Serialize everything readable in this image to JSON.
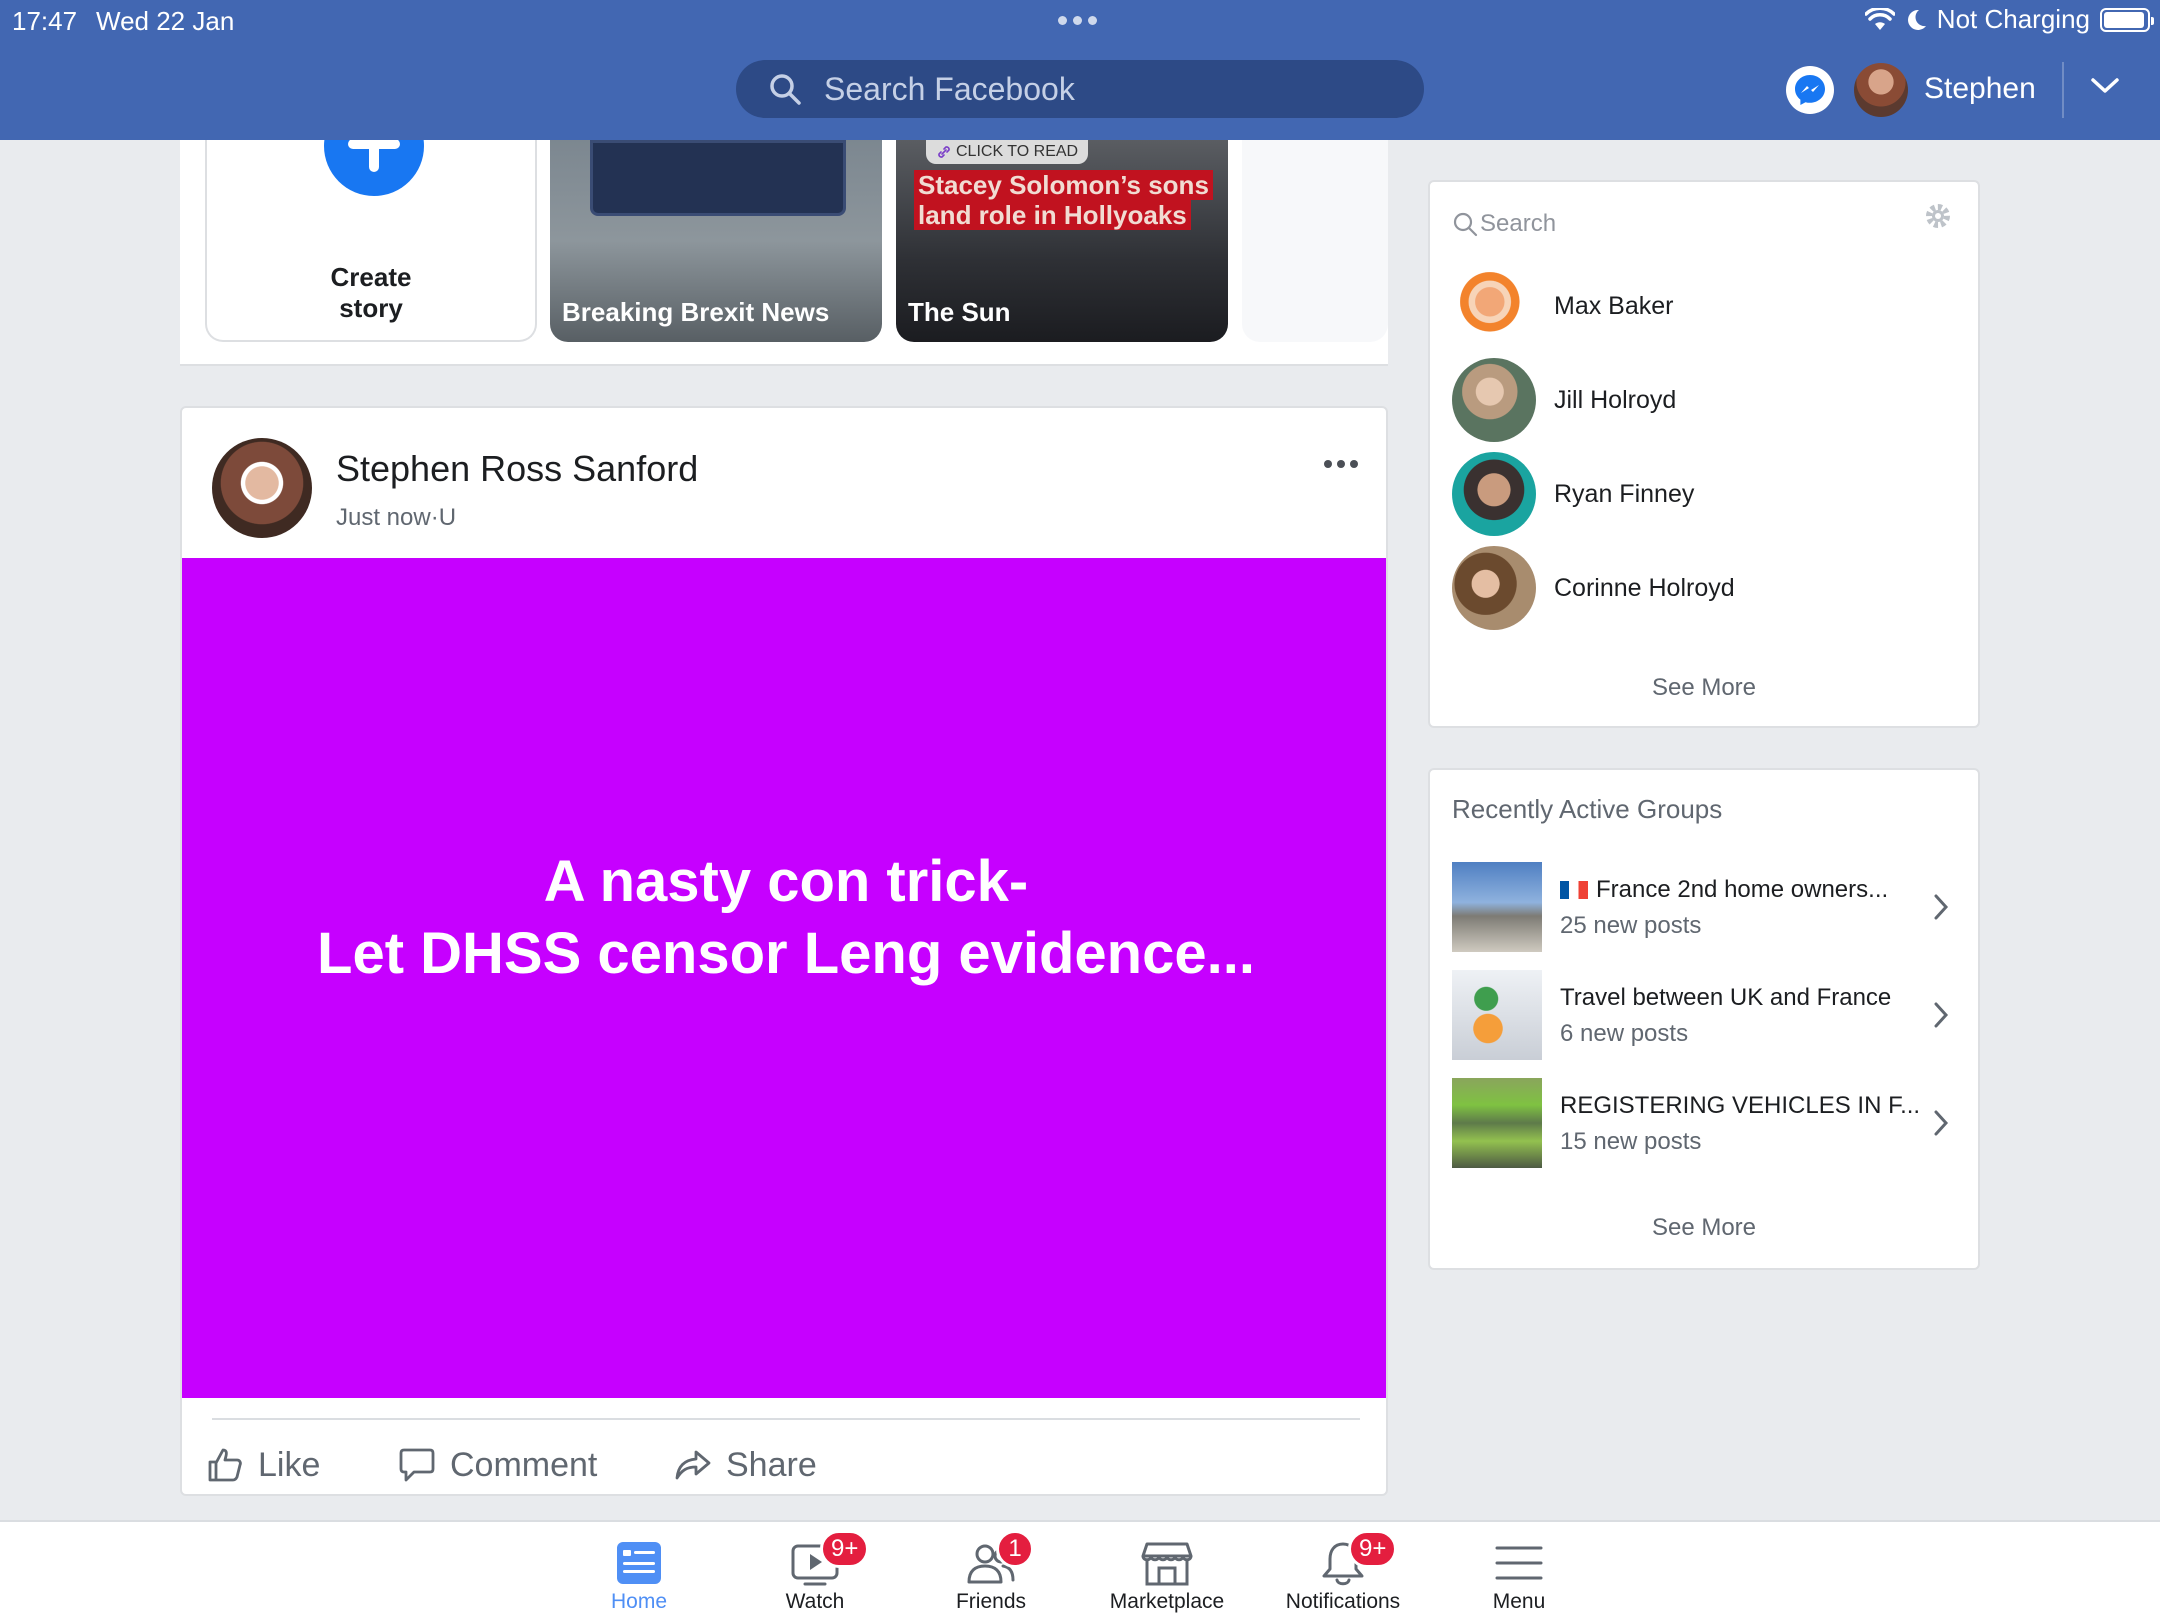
{
  "status_bar": {
    "time": "17:47",
    "date": "Wed 22 Jan",
    "battery_text": "Not Charging",
    "battery_level": 0.95
  },
  "header": {
    "search_placeholder": "Search Facebook",
    "user_name": "Stephen",
    "brand_color": "#4267b2"
  },
  "stories": {
    "create_label_line1": "Create",
    "create_label_line2": "story",
    "items": [
      {
        "name": "Breaking Brexit News"
      },
      {
        "name": "The Sun",
        "badge": "CLICK TO READ",
        "headline": "Stacey Solomon’s sons land role in Hollyoaks"
      }
    ]
  },
  "post": {
    "author": "Stephen Ross Sanford",
    "time": "Just now",
    "separator": "·",
    "audience": "U",
    "text_line1": "A nasty con trick-",
    "text_line2": "Let DHSS censor Leng evidence...",
    "background_color": "#c600ff",
    "actions": {
      "like": "Like",
      "comment": "Comment",
      "share": "Share"
    }
  },
  "contacts": {
    "search_placeholder": "Search",
    "items": [
      {
        "name": "Max Baker"
      },
      {
        "name": "Jill Holroyd"
      },
      {
        "name": "Ryan Finney"
      },
      {
        "name": "Corinne Holroyd"
      }
    ],
    "see_more": "See More"
  },
  "groups": {
    "title": "Recently Active Groups",
    "items": [
      {
        "name": "France 2nd home owners...",
        "count": "25 new posts",
        "flag": "france-flag"
      },
      {
        "name": "Travel between UK and France",
        "count": "6 new posts"
      },
      {
        "name": "REGISTERING VEHICLES IN F...",
        "count": "15 new posts"
      }
    ],
    "see_more": "See More"
  },
  "tabbar": {
    "items": [
      {
        "label": "Home",
        "icon": "home-icon",
        "active": true
      },
      {
        "label": "Watch",
        "icon": "watch-icon",
        "badge": "9+"
      },
      {
        "label": "Friends",
        "icon": "friends-icon",
        "badge": "1"
      },
      {
        "label": "Marketplace",
        "icon": "marketplace-icon"
      },
      {
        "label": "Notifications",
        "icon": "bell-icon",
        "badge": "9+"
      },
      {
        "label": "Menu",
        "icon": "menu-icon"
      }
    ],
    "active_color": "#4f8ff5",
    "badge_color": "#e41e3f"
  }
}
